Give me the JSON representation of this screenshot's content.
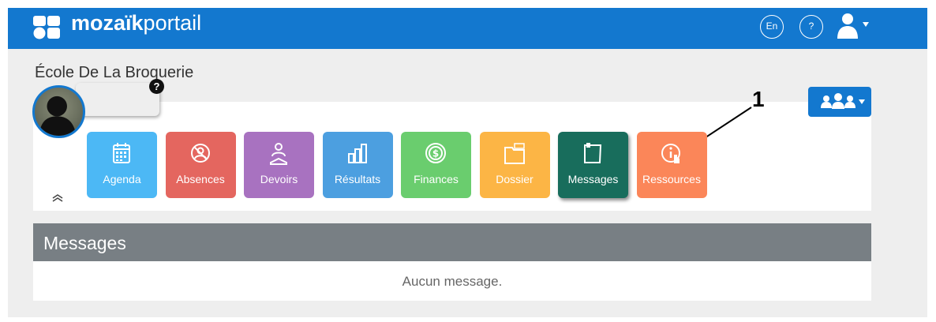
{
  "header": {
    "brand_bold": "mozaïk",
    "brand_light": "portail",
    "language_label": "En",
    "help_label": "?"
  },
  "school": {
    "name": "École De La Broquerie"
  },
  "student": {
    "help_badge": "?"
  },
  "annotation": {
    "number": "1"
  },
  "modules": [
    {
      "label": "Agenda",
      "icon": "calendar-icon",
      "color": "#4cb8f5"
    },
    {
      "label": "Absences",
      "icon": "absences-icon",
      "color": "#e4665f"
    },
    {
      "label": "Devoirs",
      "icon": "homework-icon",
      "color": "#a872c0"
    },
    {
      "label": "Résultats",
      "icon": "results-icon",
      "color": "#4c9fe0"
    },
    {
      "label": "Finances",
      "icon": "finances-icon",
      "color": "#6acd6e"
    },
    {
      "label": "Dossier",
      "icon": "folder-icon",
      "color": "#fcb545"
    },
    {
      "label": "Messages",
      "icon": "messages-icon",
      "color": "#186d5c"
    },
    {
      "label": "Ressources",
      "icon": "resources-icon",
      "color": "#fb8659"
    }
  ],
  "messages_section": {
    "title": "Messages",
    "empty_text": "Aucun message."
  },
  "colors": {
    "primary": "#1378cf",
    "section_header": "#787f84"
  }
}
